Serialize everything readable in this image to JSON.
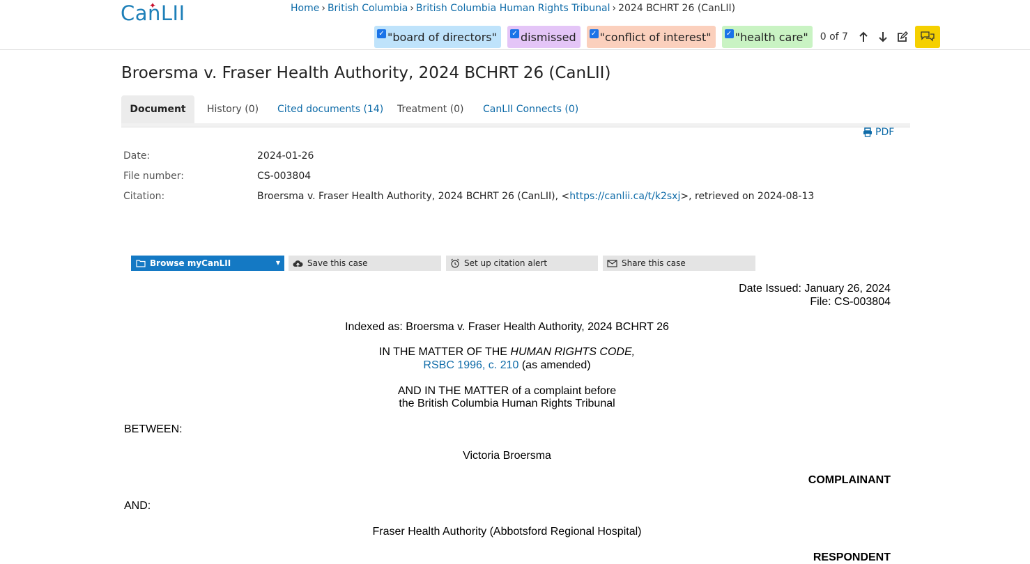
{
  "header": {
    "logo_text": "CanLII",
    "breadcrumb": {
      "home": "Home",
      "sep": "›",
      "province": "British Columbia",
      "tribunal": "British Columbia Human Rights Tribunal",
      "current": "2024 BCHRT 26 (CanLII)"
    },
    "highlights": [
      {
        "term": "\"board of directors\"",
        "color": "#bfe3fb",
        "checked": true
      },
      {
        "term": "dismissed",
        "color": "#e4c5f7",
        "checked": true
      },
      {
        "term": "\"conflict of interest\"",
        "color": "#fbd0bd",
        "checked": true
      },
      {
        "term": "\"health care\"",
        "color": "#c9f3c3",
        "checked": true
      }
    ],
    "match_counter": "0 of 7",
    "icons": [
      "arrow-up-icon",
      "arrow-down-icon",
      "edit-icon",
      "comments-icon"
    ]
  },
  "document": {
    "title": "Broersma v. Fraser Health Authority, 2024 BCHRT 26 (CanLII)",
    "tabs": [
      {
        "label": "Document",
        "active": true
      },
      {
        "label": "History (0)"
      },
      {
        "label": "Cited documents (14)"
      },
      {
        "label": "Treatment (0)"
      },
      {
        "label": "CanLII Connects (0)"
      }
    ],
    "pdf_label": "PDF",
    "meta": {
      "date_label": "Date:",
      "date_value": "2024-01-26",
      "file_label": "File number:",
      "file_value": "CS-003804",
      "citation_label": "Citation:",
      "citation_prefix": "Broersma v. Fraser Health Authority, 2024 BCHRT 26 (CanLII), <",
      "citation_url": "https://canlii.ca/t/k2sxj",
      "citation_suffix": ">, retrieved on 2024-08-13"
    },
    "actions": {
      "browse": "Browse myCanLII",
      "save": "Save this case",
      "alert": "Set up citation alert",
      "share": "Share this case"
    },
    "body": {
      "date_issued": "Date Issued: January 26, 2024",
      "file": "File: CS-003804",
      "indexed_as": "Indexed as: Broersma v. Fraser Health Authority, 2024 BCHRT 26",
      "matter_prefix": "IN THE MATTER OF THE ",
      "matter_code": "HUMAN RIGHTS CODE,",
      "statute_link": "RSBC 1996, c. 210",
      "statute_suffix": " (as amended)",
      "complaint_line1": "AND IN THE MATTER of a complaint before",
      "complaint_line2": "the British Columbia Human Rights Tribunal",
      "between": "BETWEEN:",
      "complainant_name": "Victoria Broersma",
      "complainant_role": "COMPLAINANT",
      "and": "AND:",
      "respondent_name": "Fraser Health Authority (Abbotsford Regional Hospital)",
      "respondent_role": "RESPONDENT"
    }
  }
}
